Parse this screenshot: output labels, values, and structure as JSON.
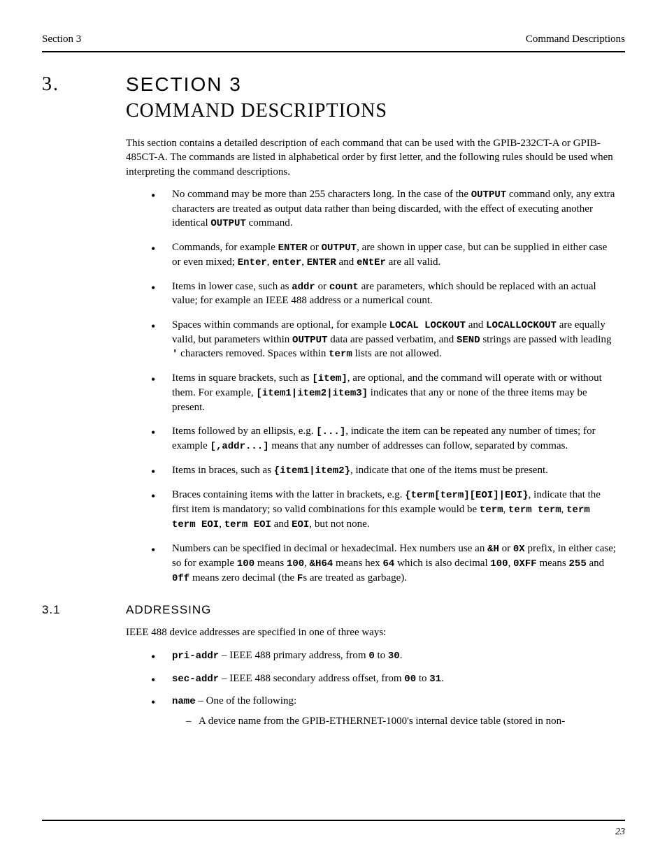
{
  "header": {
    "left": "Section 3",
    "right": "Command Descriptions"
  },
  "section": {
    "number": "3.",
    "tab": "SECTION 3",
    "title": "COMMAND DESCRIPTIONS"
  },
  "intro": "This section contains a detailed description of each command that can be used with the GPIB-232CT-A or GPIB-485CT-A. The commands are listed in alphabetical order by first letter, and the following rules should be used when interpreting the command descriptions.",
  "rules": {
    "r0_a": "No command may be more than 255 characters long. In the case of the ",
    "r0_b": "OUTPUT",
    "r0_c": " command only, any extra characters are treated as output data rather than being discarded, with the effect of executing another identical ",
    "r0_d": "OUTPUT",
    "r0_e": " command.",
    "r1_a": "Commands, for example ",
    "r1_b": "ENTER",
    "r1_c": " or ",
    "r1_d": "OUTPUT",
    "r1_e": ", are shown in upper case, but can be supplied in either case or even mixed; ",
    "r1_f": "Enter",
    "r1_g": ", ",
    "r1_h": "enter",
    "r1_i": ", ",
    "r1_j": "ENTER",
    "r1_k": " and ",
    "r1_l": "eNtEr",
    "r1_m": " are all valid.",
    "r2_a": "Items in lower case, such as ",
    "r2_b": "addr",
    "r2_c": " or ",
    "r2_d": "count",
    "r2_e": " are parameters, which should be replaced with an actual value; for example an IEEE 488 address or a numerical count.",
    "r3_a": "Spaces within commands are optional, for example ",
    "r3_b": "LOCAL LOCKOUT",
    "r3_c": " and ",
    "r3_d": "LOCALLOCKOUT",
    "r3_e": " are equally valid, but parameters within ",
    "r3_f": "OUTPUT",
    "r3_g": " data are passed verbatim, and ",
    "r3_h": "SEND",
    "r3_i": " strings are passed with leading ",
    "r3_j": "'",
    "r3_k": " characters removed. Spaces within ",
    "r3_l": "term",
    "r3_m": " lists are not allowed.",
    "r4_a": "Items in square brackets, such as ",
    "r4_b": "[item]",
    "r4_c": ", are optional, and the command will operate with or without them. For example, ",
    "r4_d": "[item1|item2|item3]",
    "r4_e": " indicates that any or none of the three items may be present.",
    "r5_a": "Items followed by an ellipsis, e.g. ",
    "r5_b": "[...]",
    "r5_c": ", indicate the item can be repeated any number of times; for example ",
    "r5_d": "[,addr...]",
    "r5_e": " means that any number of addresses can follow, separated by commas.",
    "r6_a": "Items in braces, such as ",
    "r6_b": "{item1|item2}",
    "r6_c": ", indicate that one of the items must be present.",
    "r7_a": "Braces containing items with the latter in brackets, e.g. ",
    "r7_b": "{term[term][EOI]|EOI}",
    "r7_c": ", indicate that the first item is mandatory; so valid combinations for this example would be ",
    "r7_d": "term",
    "r7_e": ", ",
    "r7_f": "term term",
    "r7_g": ", ",
    "r7_h": "term term EOI",
    "r7_i": ", ",
    "r7_j": "term EOI",
    "r7_k": " and ",
    "r7_l": "EOI",
    "r7_m": ", but not none.",
    "r8_a": "Numbers can be specified in decimal or hexadecimal. Hex numbers use an ",
    "r8_b": "&H",
    "r8_c": " or ",
    "r8_d": "0X",
    "r8_e": " prefix, in either case; so for example ",
    "r8_f": "100",
    "r8_g": " means ",
    "r8_h": "100",
    "r8_i": ", ",
    "r8_j": "&H64",
    "r8_k": " means hex ",
    "r8_l": "64",
    "r8_m": " which is also decimal ",
    "r8_n": "100",
    "r8_o": ", ",
    "r8_p": "0XFF",
    "r8_q": " means ",
    "r8_r": "255",
    "r8_s": " and ",
    "r8_t": "0ff",
    "r8_u": " means zero decimal (the ",
    "r8_v": "F",
    "r8_w": "s are treated as garbage)."
  },
  "subheading": {
    "number": "3.1",
    "title": "ADDRESSING"
  },
  "addressing_para": "IEEE 488 device addresses are specified in one of three ways:",
  "addr": {
    "a0_b": "pri-addr",
    "a0_c": " – IEEE 488 primary address, from ",
    "a0_d": "0",
    "a0_e": " to ",
    "a0_f": "30",
    "a0_g": ".",
    "a1_b": "sec-addr",
    "a1_c": " – IEEE 488 secondary address offset, from ",
    "a1_d": "00",
    "a1_e": " to ",
    "a1_f": "31",
    "a1_g": ".",
    "a2_b": "name",
    "a2_c": " – One of the following:",
    "a2_sub": "A device name from the GPIB-ETHERNET-1000's internal device table (stored in non-"
  },
  "page_number": "23"
}
